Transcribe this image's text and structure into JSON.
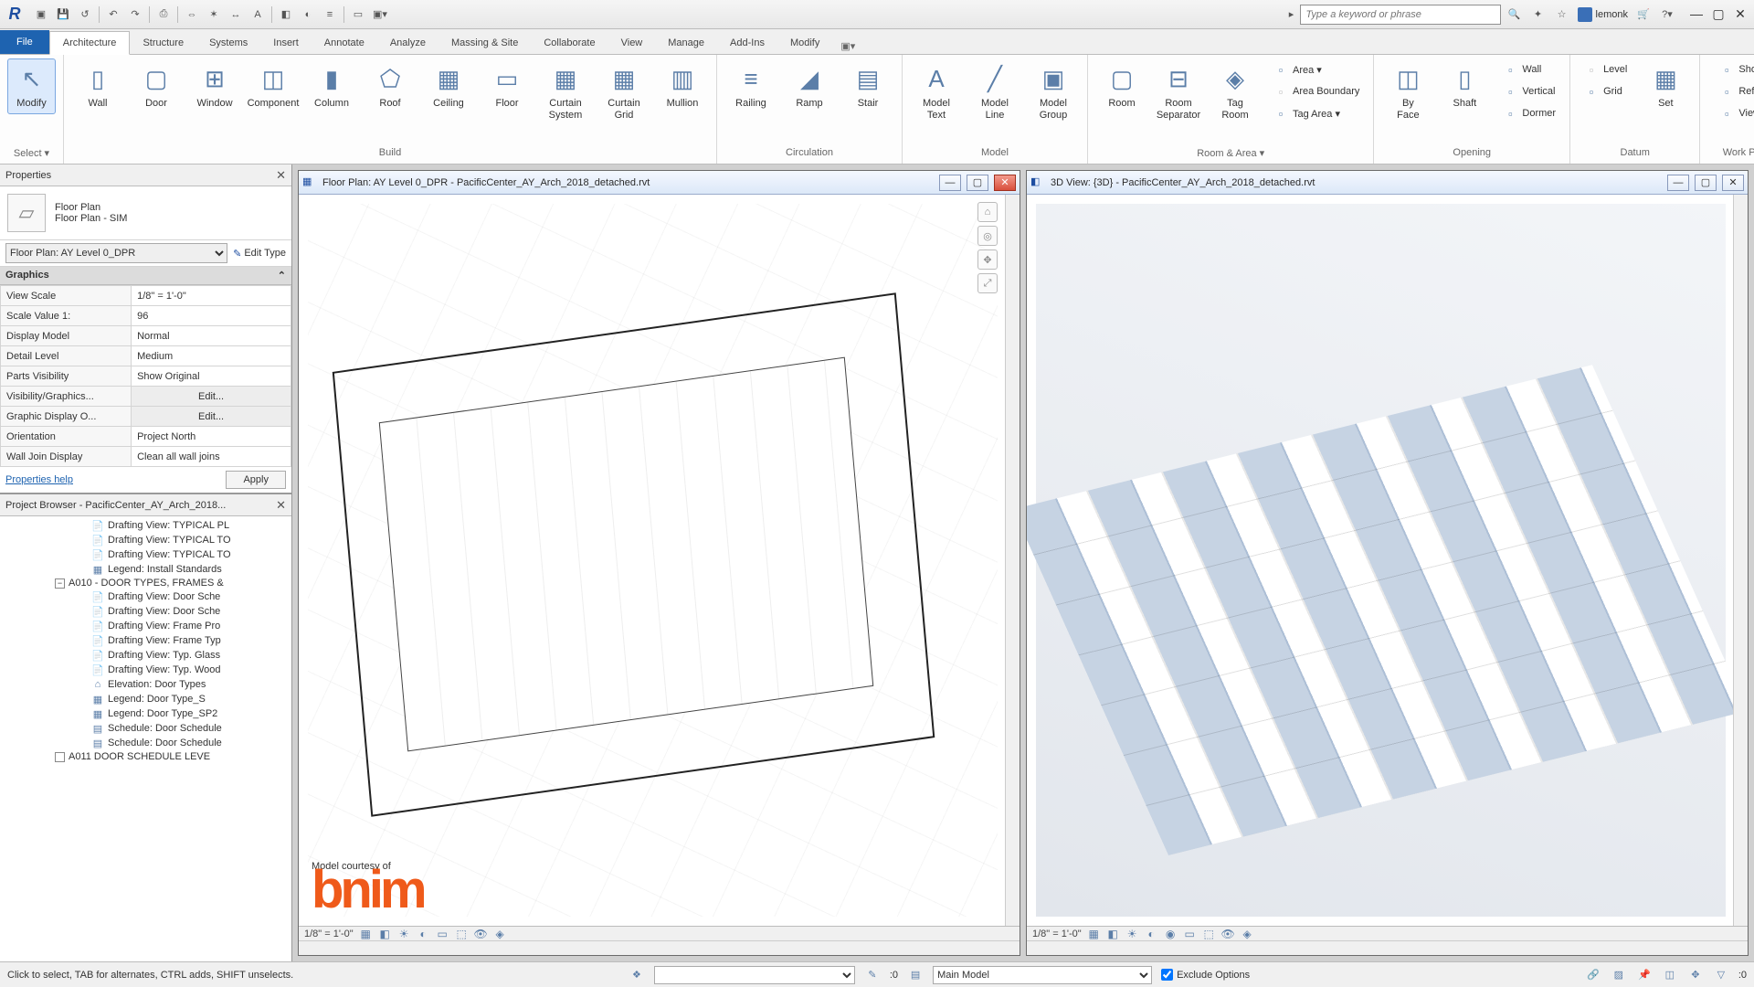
{
  "titlebar": {
    "search_placeholder": "Type a keyword or phrase",
    "username": "lemonk"
  },
  "tabs": [
    "File",
    "Architecture",
    "Structure",
    "Systems",
    "Insert",
    "Annotate",
    "Analyze",
    "Massing & Site",
    "Collaborate",
    "View",
    "Manage",
    "Add-Ins",
    "Modify"
  ],
  "active_tab": "Architecture",
  "ribbon": {
    "select": "Select ▾",
    "modify": "Modify",
    "build": {
      "label": "Build",
      "items": [
        "Wall",
        "Door",
        "Window",
        "Component",
        "Column",
        "Roof",
        "Ceiling",
        "Floor",
        "Curtain System",
        "Curtain Grid",
        "Mullion"
      ]
    },
    "circulation": {
      "label": "Circulation",
      "items": [
        "Railing",
        "Ramp",
        "Stair"
      ]
    },
    "model": {
      "label": "Model",
      "items": [
        "Model Text",
        "Model Line",
        "Model Group"
      ]
    },
    "room_area": {
      "label": "Room & Area ▾",
      "big": [
        "Room",
        "Room Separator",
        "Tag Room"
      ],
      "small": [
        "Area  ▾",
        "Area Boundary",
        "Tag Area  ▾"
      ]
    },
    "opening": {
      "label": "Opening",
      "big": [
        "By Face",
        "Shaft"
      ],
      "small": [
        "Wall",
        "Vertical",
        "Dormer"
      ]
    },
    "datum": {
      "label": "Datum",
      "big": [
        "Set"
      ],
      "small": [
        "Level",
        "Grid"
      ]
    },
    "work_plane": {
      "label": "Work Plane",
      "small": [
        "Show",
        "Ref Plane",
        "Viewer"
      ]
    }
  },
  "properties": {
    "title": "Properties",
    "type_name": "Floor Plan",
    "type_sub": "Floor Plan - SIM",
    "instance": "Floor Plan: AY Level 0_DPR",
    "edit_type": "Edit Type",
    "category": "Graphics",
    "rows": [
      {
        "n": "View Scale",
        "v": "1/8\" = 1'-0\""
      },
      {
        "n": "Scale Value    1:",
        "v": "96"
      },
      {
        "n": "Display Model",
        "v": "Normal"
      },
      {
        "n": "Detail Level",
        "v": "Medium"
      },
      {
        "n": "Parts Visibility",
        "v": "Show Original"
      },
      {
        "n": "Visibility/Graphics...",
        "v": "Edit...",
        "btn": true
      },
      {
        "n": "Graphic Display O...",
        "v": "Edit...",
        "btn": true
      },
      {
        "n": "Orientation",
        "v": "Project North"
      },
      {
        "n": "Wall Join Display",
        "v": "Clean all wall joins"
      }
    ],
    "help": "Properties help",
    "apply": "Apply"
  },
  "browser": {
    "title": "Project Browser - PacificCenter_AY_Arch_2018...",
    "nodes": [
      {
        "l": 2,
        "i": "📄",
        "t": "Drafting View: TYPICAL PL"
      },
      {
        "l": 2,
        "i": "📄",
        "t": "Drafting View: TYPICAL TO"
      },
      {
        "l": 2,
        "i": "📄",
        "t": "Drafting View: TYPICAL TO"
      },
      {
        "l": 2,
        "i": "▦",
        "t": "Legend: Install Standards"
      },
      {
        "l": 1,
        "tw": "−",
        "t": "A010 - DOOR TYPES, FRAMES &"
      },
      {
        "l": 2,
        "i": "📄",
        "t": "Drafting View: Door Sche"
      },
      {
        "l": 2,
        "i": "📄",
        "t": "Drafting View: Door Sche"
      },
      {
        "l": 2,
        "i": "📄",
        "t": "Drafting View: Frame Pro"
      },
      {
        "l": 2,
        "i": "📄",
        "t": "Drafting View: Frame Typ"
      },
      {
        "l": 2,
        "i": "📄",
        "t": "Drafting View: Typ. Glass"
      },
      {
        "l": 2,
        "i": "📄",
        "t": "Drafting View: Typ. Wood"
      },
      {
        "l": 2,
        "i": "⌂",
        "t": "Elevation: Door Types"
      },
      {
        "l": 2,
        "i": "▦",
        "t": "Legend: Door Type_S"
      },
      {
        "l": 2,
        "i": "▦",
        "t": "Legend: Door Type_SP2"
      },
      {
        "l": 2,
        "i": "▤",
        "t": "Schedule: Door Schedule"
      },
      {
        "l": 2,
        "i": "▤",
        "t": "Schedule: Door Schedule"
      },
      {
        "l": 1,
        "tw": "",
        "t": "A011   DOOR SCHEDULE   LEVE"
      }
    ]
  },
  "views": {
    "left": {
      "title": "Floor Plan: AY Level 0_DPR - PacificCenter_AY_Arch_2018_detached.rvt",
      "scale": "1/8\" = 1'-0\"",
      "credit_top": "Model courtesy of",
      "credit_logo": "bnim"
    },
    "right": {
      "title": "3D View: {3D} - PacificCenter_AY_Arch_2018_detached.rvt",
      "scale": "1/8\" = 1'-0\""
    }
  },
  "status": {
    "msg": "Click to select, TAB for alternates, CTRL adds, SHIFT unselects.",
    "sel_count": ":0",
    "workset": "Main Model",
    "exclude": "Exclude Options",
    "filter_count": ":0"
  }
}
